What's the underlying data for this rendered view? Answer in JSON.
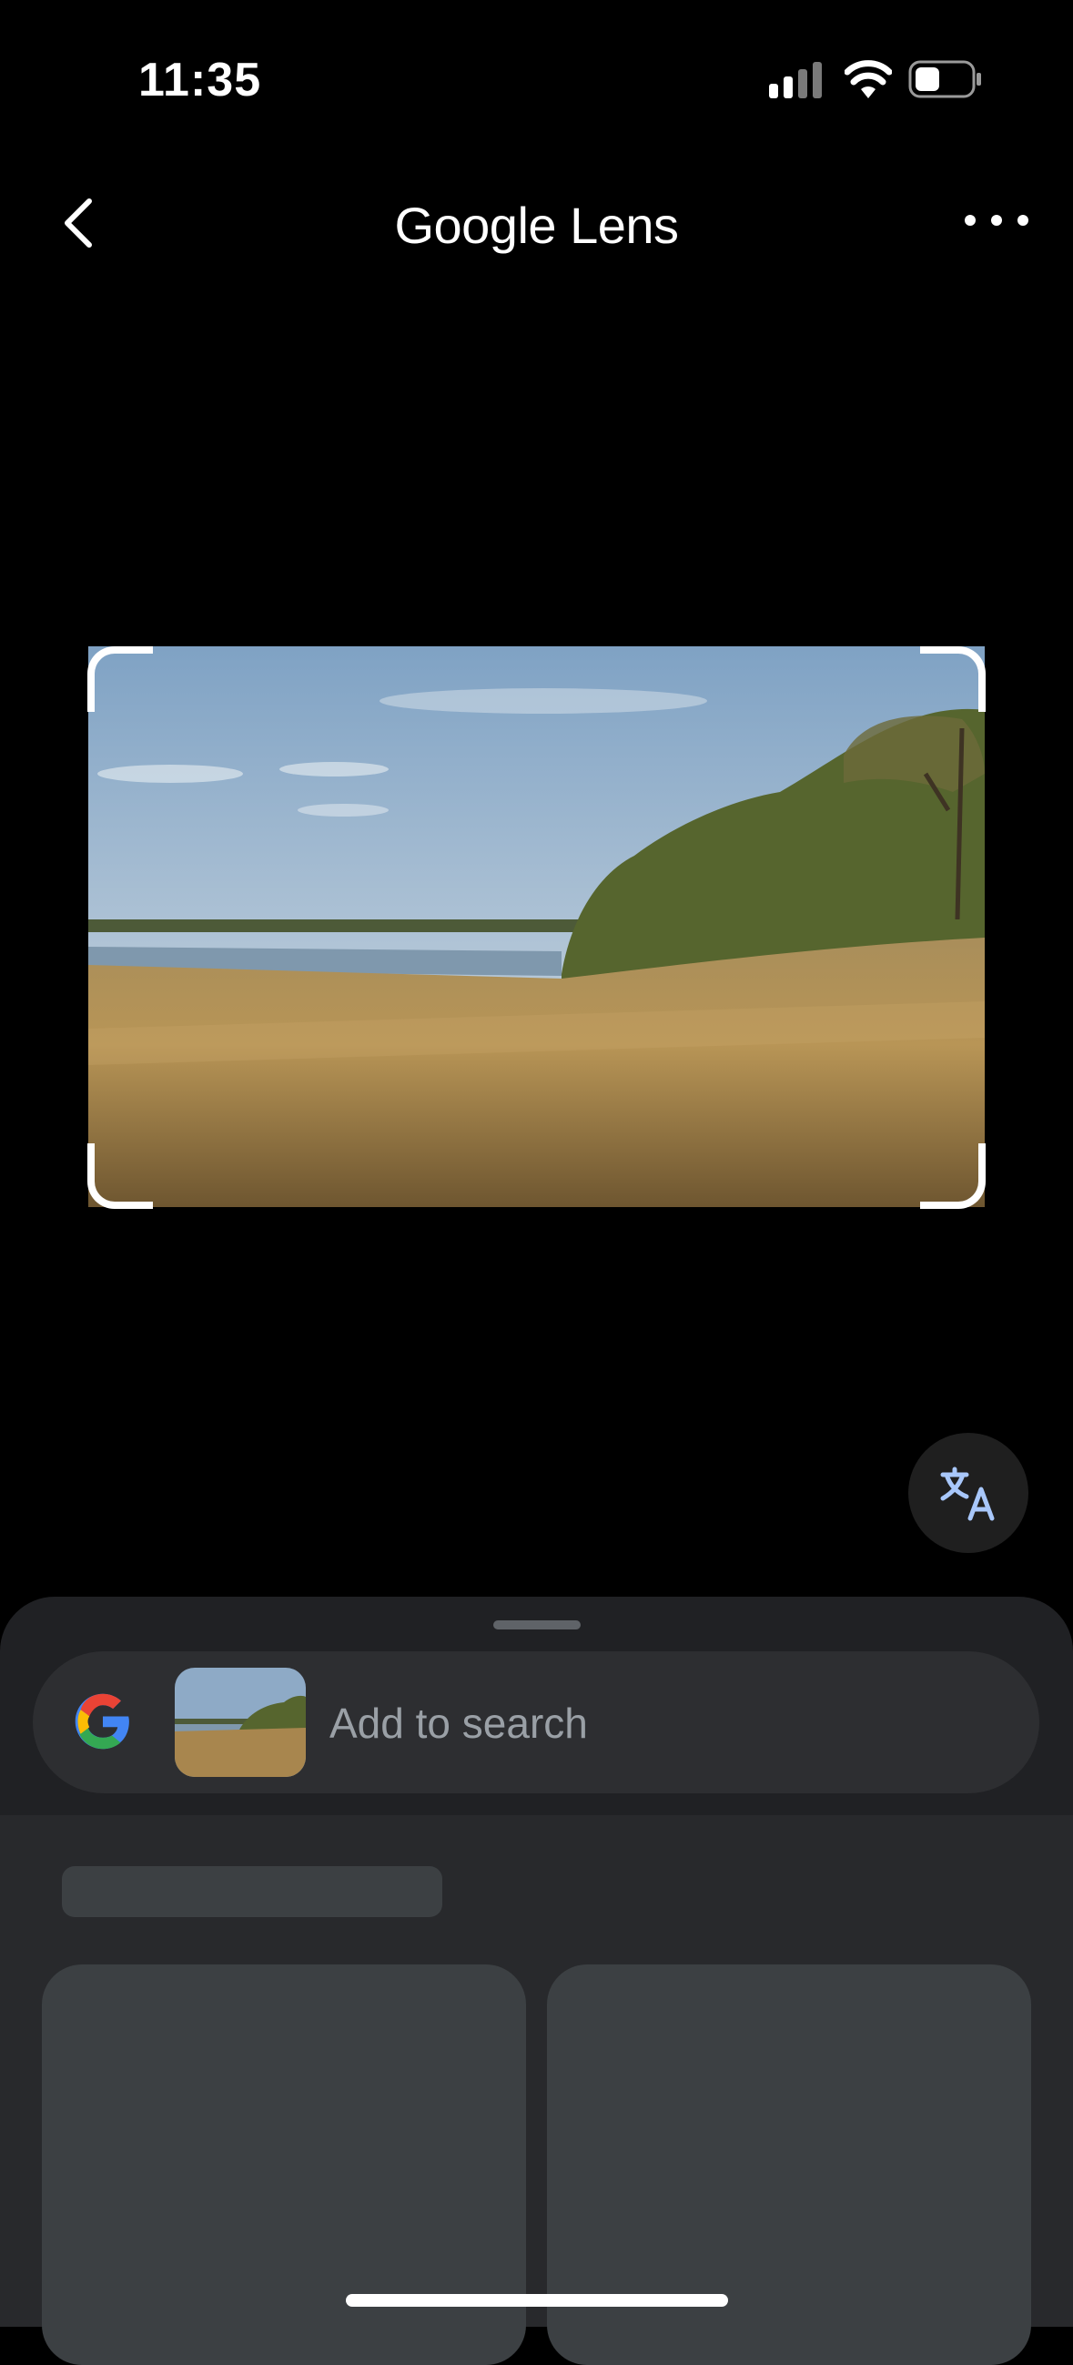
{
  "status_bar": {
    "time": "11:35",
    "icons": [
      "signal-icon",
      "wifi-icon",
      "battery-icon"
    ]
  },
  "header": {
    "title_part1": "Google",
    "title_part2": "Lens",
    "back_icon": "chevron-left-icon",
    "more_icon": "more-horizontal-icon"
  },
  "image": {
    "description_icon": "landscape-photo"
  },
  "fab": {
    "icon": "translate-icon",
    "accent": "#a8c7fa"
  },
  "bottom_sheet": {
    "search": {
      "placeholder": "Add to search",
      "logo": "google-g-icon"
    }
  },
  "colors": {
    "background": "#000000",
    "sheet": "#202124",
    "search_bar": "#2d2e31",
    "skeleton": "#3c4043",
    "placeholder_text": "#9aa0a6"
  }
}
